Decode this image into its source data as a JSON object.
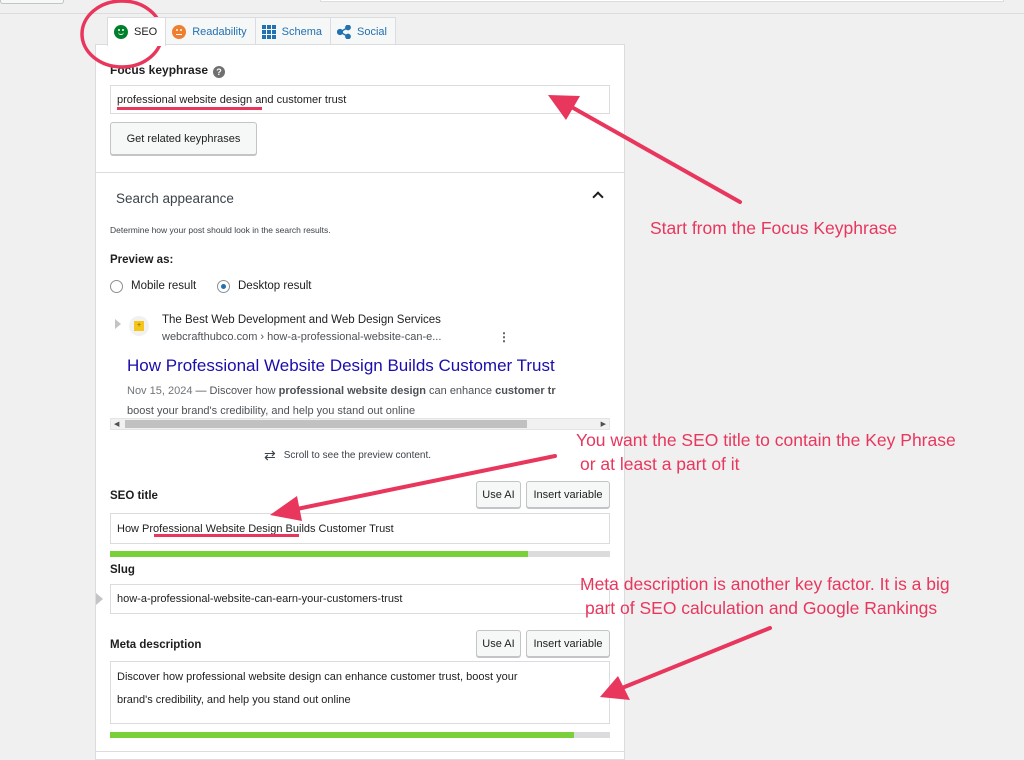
{
  "tabs": [
    {
      "label": "SEO",
      "icon": "smiley-green-icon"
    },
    {
      "label": "Readability",
      "icon": "smiley-orange-icon"
    },
    {
      "label": "Schema",
      "icon": "grid-icon"
    },
    {
      "label": "Social",
      "icon": "share-icon"
    }
  ],
  "focus": {
    "label": "Focus keyphrase",
    "help_icon": "?",
    "value": "professional website design and customer trust",
    "related_button": "Get related keyphrases"
  },
  "search_appearance": {
    "title": "Search appearance",
    "help_text": "Determine how your post should look in the search results.",
    "preview_label": "Preview as:",
    "options": [
      "Mobile result",
      "Desktop result"
    ],
    "selected": "Desktop result"
  },
  "serp": {
    "site_name": "The Best Web Development and Web Design Services",
    "url": "webcrafthubco.com › how-a-professional-website-can-e...",
    "title": "How Professional Website Design Builds Customer Trust",
    "date": "Nov 15, 2024",
    "desc_line1_pre": " — Discover how ",
    "desc_bold1": "professional website design",
    "desc_line1_mid": " can enhance ",
    "desc_bold2": "customer tr",
    "desc_line2": "boost your brand's credibility, and help you stand out online",
    "scroll_hint": "Scroll to see the preview content."
  },
  "seo_title": {
    "label": "SEO title",
    "use_ai": "Use AI",
    "insert_variable": "Insert variable",
    "value": "How Professional Website Design Builds Customer Trust",
    "progress": 0.836
  },
  "slug": {
    "label": "Slug",
    "value": "how-a-professional-website-can-earn-your-customers-trust"
  },
  "meta": {
    "label": "Meta description",
    "use_ai": "Use AI",
    "insert_variable": "Insert variable",
    "value_line1": "Discover how professional website design can enhance customer trust, boost your",
    "value_line2": "brand's credibility, and help you stand out online",
    "progress": 0.928
  },
  "annotations": {
    "focus": "Start from the Focus Keyphrase",
    "seo_title_1": "You want the SEO title to contain the Key Phrase",
    "seo_title_2": "or at least a part of it",
    "meta_1": "Meta description is another key factor. It is a big",
    "meta_2": "part of SEO calculation and Google Rankings",
    "color": "#e8365d"
  }
}
